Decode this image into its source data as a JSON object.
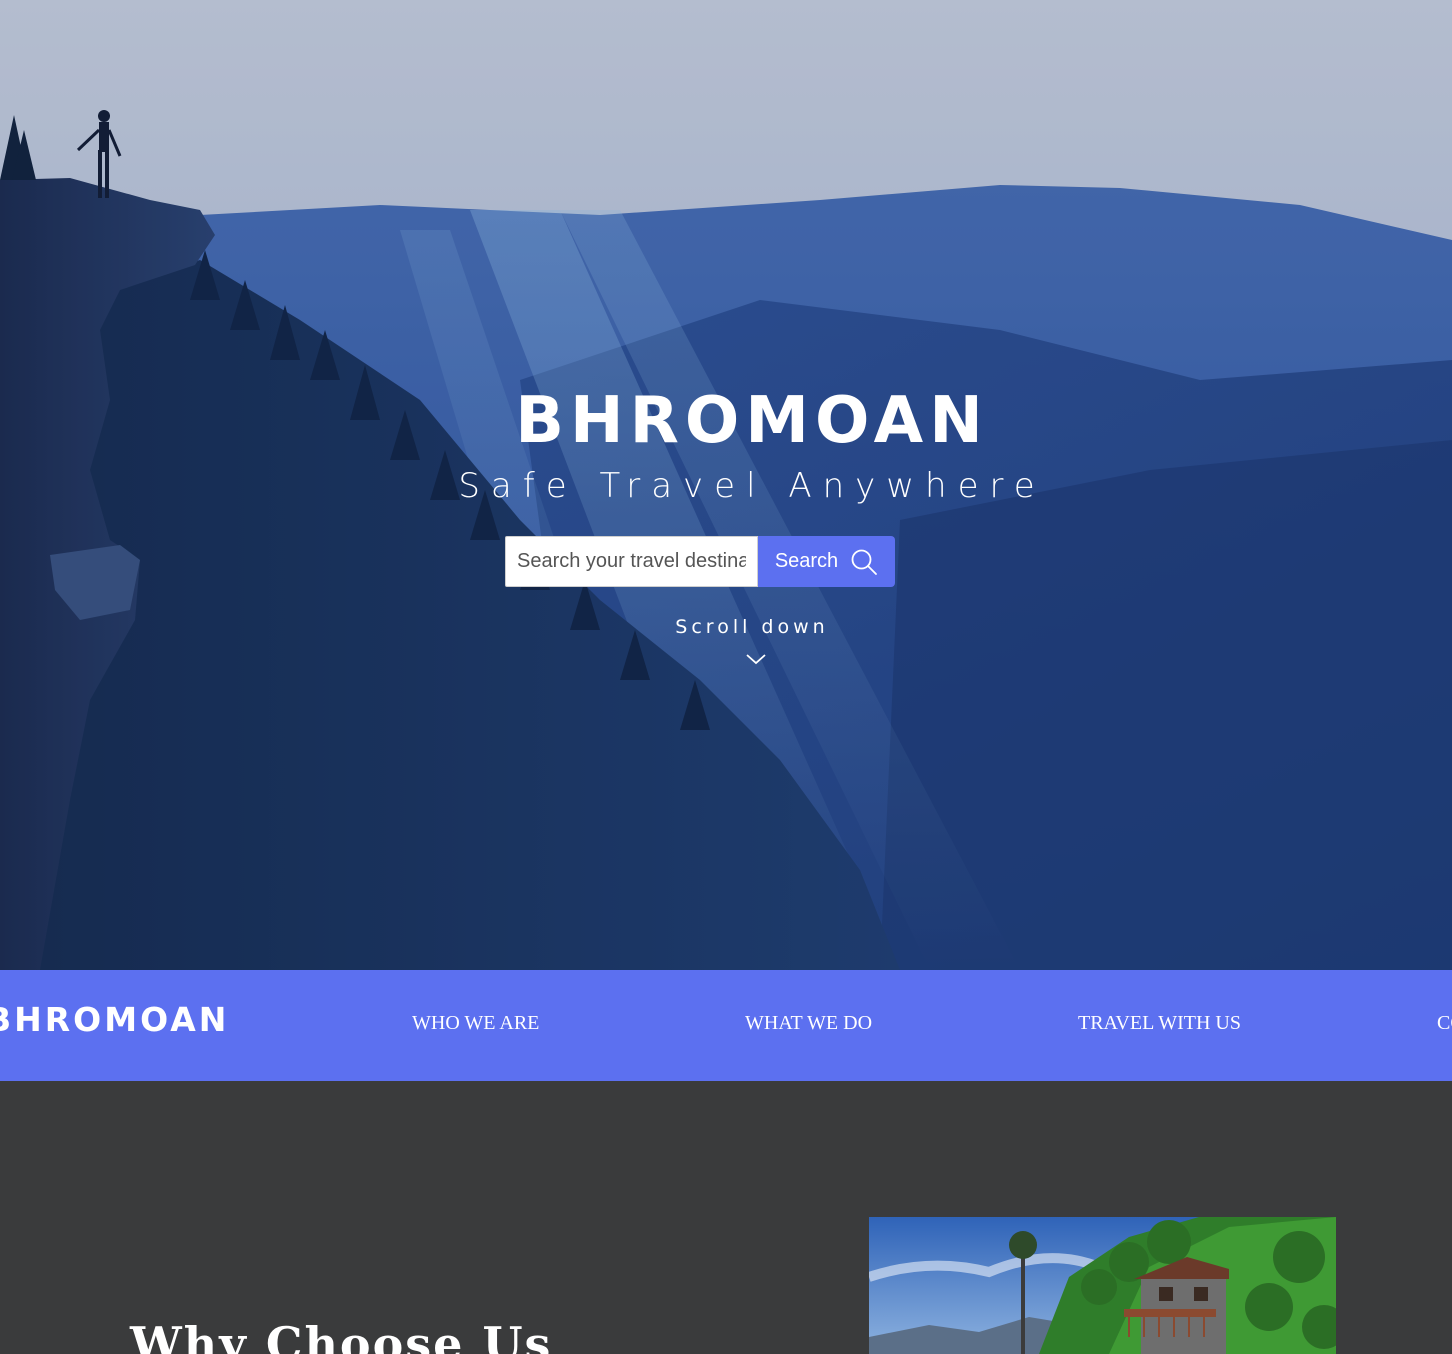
{
  "hero": {
    "title": "BHROMOAN",
    "tagline": "Safe Travel Anywhere",
    "search": {
      "placeholder": "Search your travel destination",
      "button_label": "Search"
    },
    "scroll_label": "Scroll down"
  },
  "nav": {
    "logo": "BHROMOAN",
    "items": [
      "WHO WE ARE",
      "WHAT WE DO",
      "TRAVEL WITH US",
      "CONTACT"
    ]
  },
  "section": {
    "heading": "Why Choose Us"
  },
  "colors": {
    "accent": "#5c70f0",
    "dark_bg": "#3a3b3c"
  },
  "icons": {
    "search": "search-icon",
    "scroll": "chevron-down-icon"
  }
}
